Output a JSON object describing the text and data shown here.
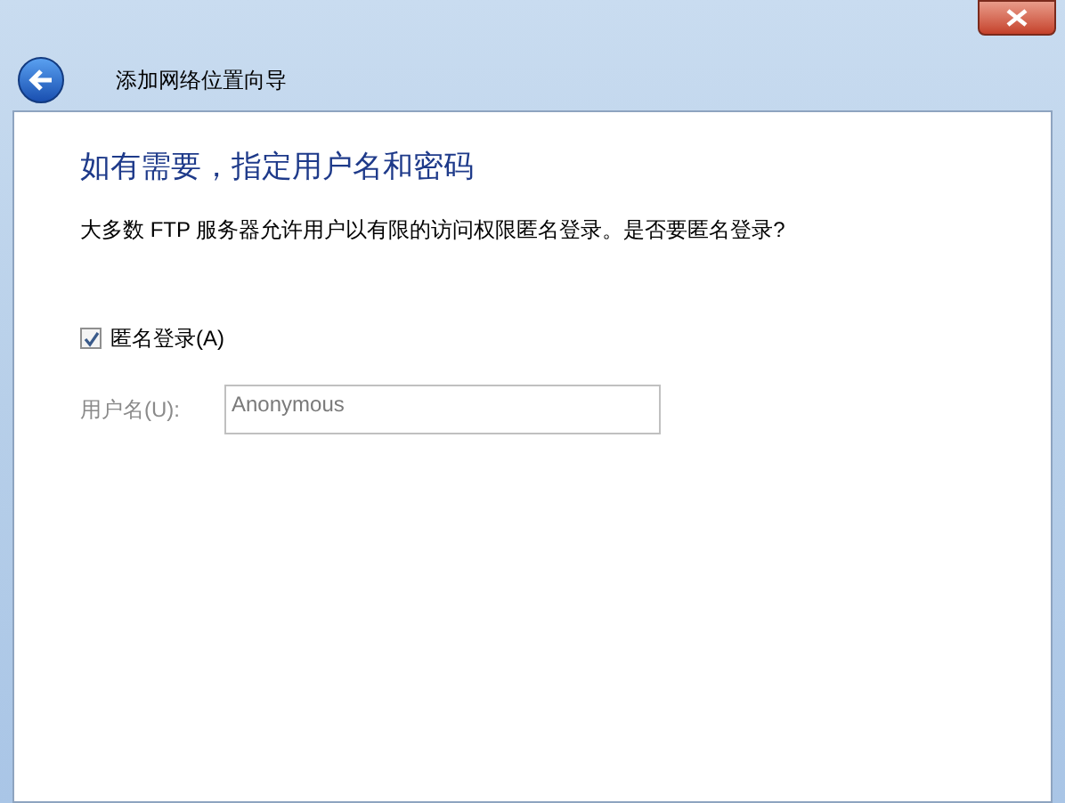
{
  "window": {
    "title": "添加网络位置向导"
  },
  "heading": "如有需要，指定用户名和密码",
  "description": "大多数 FTP 服务器允许用户以有限的访问权限匿名登录。是否要匿名登录?",
  "anonymous_login": {
    "label": "匿名登录(A)",
    "checked": true
  },
  "username": {
    "label": "用户名(U):",
    "value": "Anonymous",
    "disabled": true
  }
}
